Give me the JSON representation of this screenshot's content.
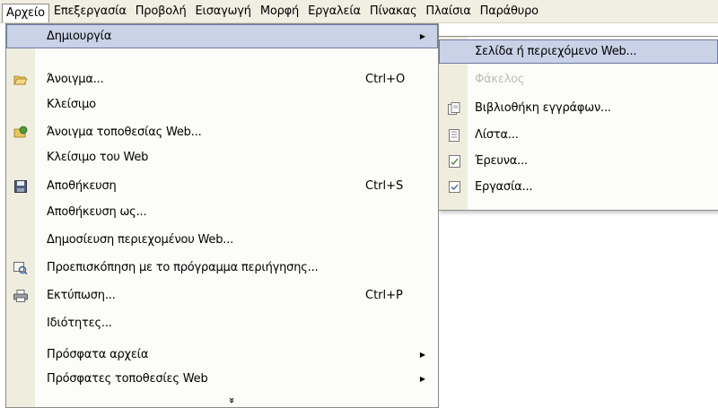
{
  "menubar": {
    "items": [
      {
        "label": "Αρχείο",
        "active": true
      },
      {
        "label": "Επεξεργασία"
      },
      {
        "label": "Προβολή"
      },
      {
        "label": "Εισαγωγή"
      },
      {
        "label": "Μορφή"
      },
      {
        "label": "Εργαλεία"
      },
      {
        "label": "Πίνακας"
      },
      {
        "label": "Πλαίσια"
      },
      {
        "label": "Παράθυρο"
      }
    ]
  },
  "file_menu": {
    "new": {
      "label": "Δημιουργία"
    },
    "open": {
      "label": "Άνοιγμα...",
      "shortcut": "Ctrl+O",
      "icon": "open-folder-icon"
    },
    "close": {
      "label": "Κλείσιμο"
    },
    "open_web": {
      "label": "Άνοιγμα τοποθεσίας Web...",
      "icon": "open-web-icon"
    },
    "close_web": {
      "label": "Κλείσιμο του Web"
    },
    "save": {
      "label": "Αποθήκευση",
      "shortcut": "Ctrl+S",
      "icon": "floppy-disk-icon"
    },
    "save_as": {
      "label": "Αποθήκευση ως..."
    },
    "publish": {
      "label": "Δημοσίευση περιεχομένου Web..."
    },
    "preview": {
      "label": "Προεπισκόπηση με το πρόγραμμα περιήγησης...",
      "icon": "browser-preview-icon"
    },
    "print": {
      "label": "Εκτύπωση...",
      "shortcut": "Ctrl+P",
      "icon": "printer-icon"
    },
    "properties": {
      "label": "Ιδιότητες..."
    },
    "recent_files": {
      "label": "Πρόσφατα αρχεία"
    },
    "recent_sites": {
      "label": "Πρόσφατες τοποθεσίες Web"
    },
    "expand": "»"
  },
  "new_submenu": {
    "page": {
      "label": "Σελίδα ή περιεχόμενο Web..."
    },
    "folder": {
      "label": "Φάκελος",
      "disabled": true
    },
    "library": {
      "label": "Βιβλιοθήκη εγγράφων...",
      "icon": "document-library-icon"
    },
    "list": {
      "label": "Λίστα...",
      "icon": "list-icon"
    },
    "survey": {
      "label": "Έρευνα...",
      "icon": "survey-icon"
    },
    "task": {
      "label": "Εργασία...",
      "icon": "task-icon"
    }
  },
  "colors": {
    "menubar_bg": "#f1efe2",
    "gutter": "#efedde",
    "highlight": "#c9d2e6",
    "highlight_border": "#6b7aa5"
  }
}
